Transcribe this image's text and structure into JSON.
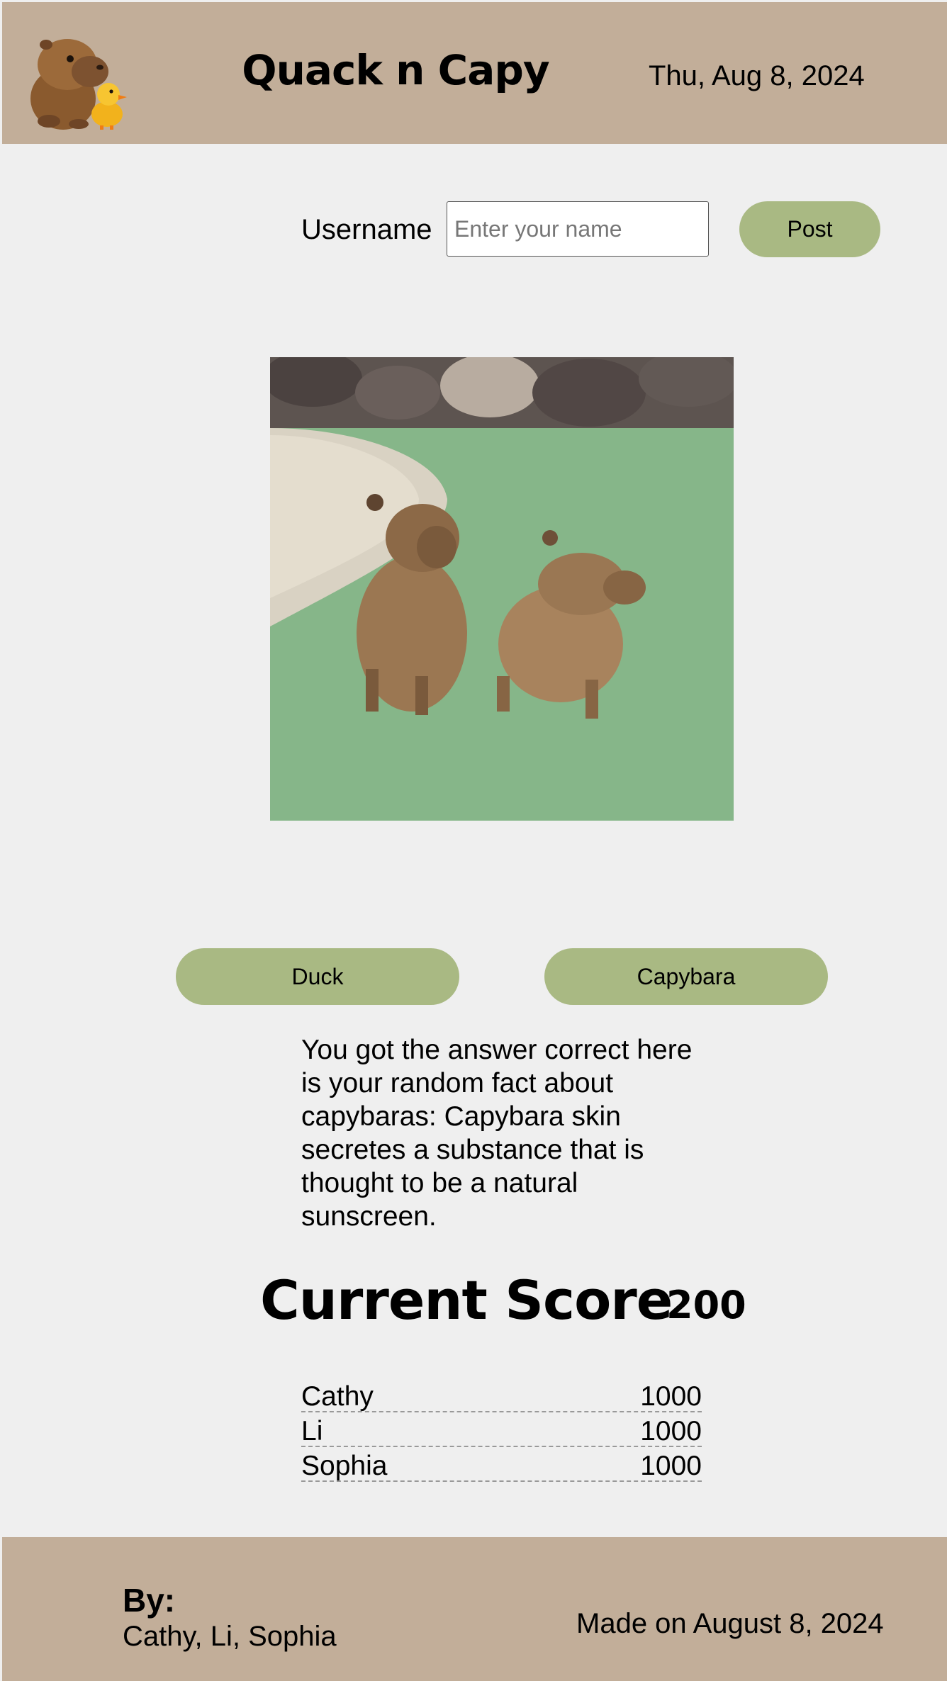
{
  "header": {
    "title": "Quack n Capy",
    "date": "Thu, Aug 8, 2024",
    "logo_icon": "capybara-and-duckling-icon"
  },
  "user_form": {
    "label": "Username",
    "placeholder": "Enter your name",
    "value": "",
    "post_label": "Post"
  },
  "photo": {
    "icon": "capybara-photo"
  },
  "answers": {
    "duck_label": "Duck",
    "capybara_label": "Capybara"
  },
  "fact": {
    "text": "You got the answer correct here is your random fact about capybaras: Capybara skin secretes a substance that is thought to be a natural sunscreen."
  },
  "score": {
    "label": "Current Score",
    "value": "200"
  },
  "leaderboard": [
    {
      "name": "Cathy",
      "score": "1000"
    },
    {
      "name": "Li",
      "score": "1000"
    },
    {
      "name": "Sophia",
      "score": "1000"
    }
  ],
  "footer": {
    "by_label": "By:",
    "authors": "Cathy, Li, Sophia",
    "made_on": "Made on August 8, 2024"
  },
  "colors": {
    "header_bg": "#c2ae99",
    "page_bg": "#efefef",
    "button_bg": "#a9b983"
  }
}
